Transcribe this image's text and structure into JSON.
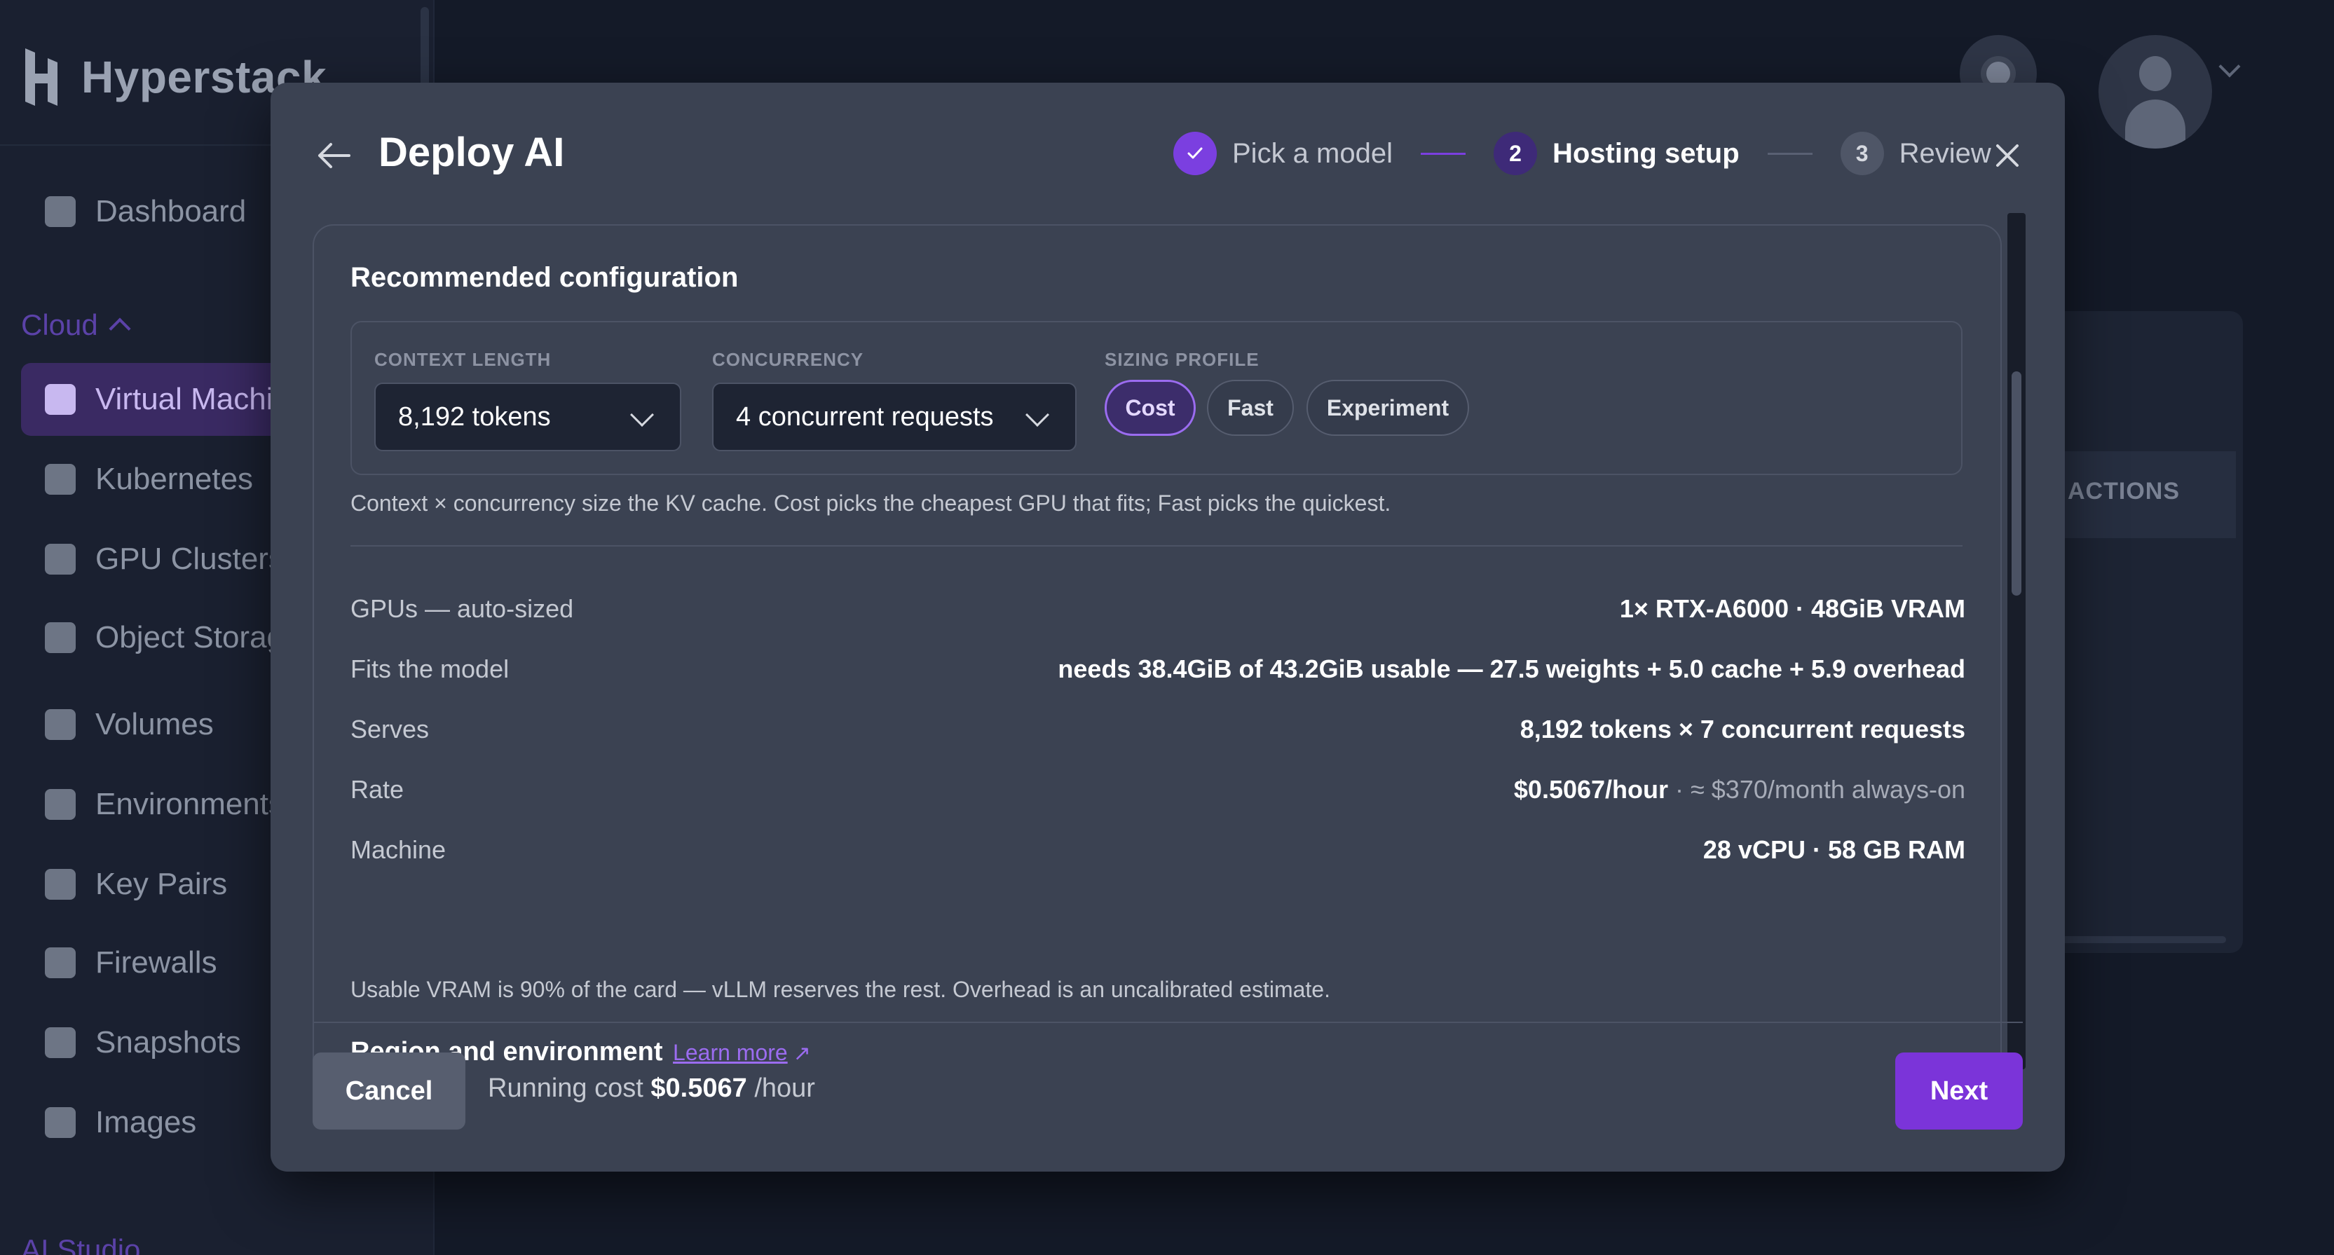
{
  "app": {
    "brand": "Hyperstack",
    "sidebar": {
      "items": [
        {
          "label": "Dashboard",
          "icon": "dashboard-icon"
        },
        {
          "label": "Virtual Machines",
          "icon": "chip-icon",
          "active": true
        },
        {
          "label": "Kubernetes",
          "icon": "cube-icon"
        },
        {
          "label": "GPU Clusters",
          "icon": "grid-icon"
        },
        {
          "label": "Object Storage",
          "icon": "database-icon"
        },
        {
          "label": "Volumes",
          "icon": "stack-icon"
        },
        {
          "label": "Environments",
          "icon": "cloud-icon"
        },
        {
          "label": "Key Pairs",
          "icon": "key-icon"
        },
        {
          "label": "Firewalls",
          "icon": "shield-icon"
        },
        {
          "label": "Snapshots",
          "icon": "camera-folder-icon"
        },
        {
          "label": "Images",
          "icon": "image-folder-icon"
        }
      ],
      "sections": {
        "cloud": "Cloud",
        "ai_studio": "AI Studio"
      }
    },
    "background_table_header": "ACTIONS"
  },
  "modal": {
    "title": "Deploy AI",
    "steps": [
      {
        "label": "Pick a model",
        "state": "done",
        "marker": "✓"
      },
      {
        "label": "Hosting setup",
        "state": "current",
        "marker": "2"
      },
      {
        "label": "Review",
        "state": "todo",
        "marker": "3"
      }
    ],
    "card": {
      "title": "Recommended configuration",
      "context_length": {
        "label": "CONTEXT LENGTH",
        "value": "8,192 tokens"
      },
      "concurrency": {
        "label": "CONCURRENCY",
        "value": "4 concurrent requests"
      },
      "sizing_profile": {
        "label": "SIZING PROFILE",
        "options": [
          "Cost",
          "Fast",
          "Experiment"
        ],
        "selected": "Cost"
      },
      "hint": "Context × concurrency size the KV cache. Cost picks the cheapest GPU that fits; Fast picks the quickest.",
      "rows": [
        {
          "label": "GPUs — auto-sized",
          "value": "1× RTX-A6000 · 48GiB VRAM"
        },
        {
          "label": "Fits the model",
          "value": "needs 38.4GiB of 43.2GiB usable — 27.5 weights + 5.0 cache + 5.9 overhead"
        },
        {
          "label": "Serves",
          "value": "8,192 tokens × 7 concurrent requests"
        },
        {
          "label": "Rate",
          "value": "$0.5067/hour",
          "secondary": " · ≈ $370/month always-on"
        },
        {
          "label": "Machine",
          "value": "28 vCPU · 58 GB RAM"
        }
      ],
      "note": "Usable VRAM is 90% of the card — vLLM reserves the rest. Overhead is an uncalibrated estimate.",
      "region_title": "Region and environment",
      "learn_more": "Learn more",
      "learn_more_icon": "↗"
    },
    "footer": {
      "cancel": "Cancel",
      "running_cost_prefix": "Running cost",
      "running_cost_value": "$0.5067",
      "running_cost_unit": "/hour",
      "next": "Next"
    }
  },
  "colors": {
    "accent": "#7b34d9",
    "modal_bg": "#3b4252",
    "page_bg": "#141a28"
  }
}
